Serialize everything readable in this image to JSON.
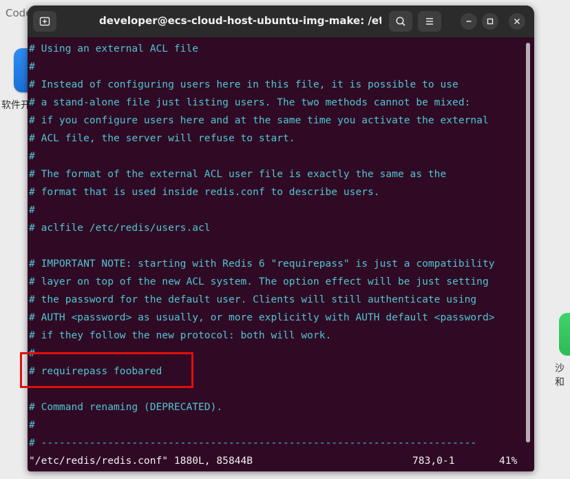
{
  "desktop": {
    "top_left_label": "Code",
    "left_icon_label": "软件开",
    "right_icon_label": "沙和"
  },
  "window": {
    "title": "developer@ecs-cloud-host-ubuntu-img-make: /etc/redis",
    "icons": {
      "new_tab": "new-tab-icon",
      "search": "search-icon",
      "menu": "hamburger-menu-icon",
      "minimize": "minimize-icon",
      "maximize": "maximize-icon",
      "close": "close-icon"
    }
  },
  "terminal": {
    "text_color": "#4ec6d3",
    "background": "#300a24",
    "lines": [
      "# Using an external ACL file",
      "#",
      "# Instead of configuring users here in this file, it is possible to use",
      "# a stand-alone file just listing users. The two methods cannot be mixed:",
      "# if you configure users here and at the same time you activate the external",
      "# ACL file, the server will refuse to start.",
      "#",
      "# The format of the external ACL user file is exactly the same as the",
      "# format that is used inside redis.conf to describe users.",
      "#",
      "# aclfile /etc/redis/users.acl",
      "",
      "# IMPORTANT NOTE: starting with Redis 6 \"requirepass\" is just a compatibility",
      "# layer on top of the new ACL system. The option effect will be just setting",
      "# the password for the default user. Clients will still authenticate using",
      "# AUTH <password> as usually, or more explicitly with AUTH default <password>",
      "# if they follow the new protocol: both will work.",
      "#",
      "# requirepass foobared",
      "",
      "# Command renaming (DEPRECATED).",
      "#",
      "# ------------------------------------------------------------------------"
    ],
    "status": {
      "file": "\"/etc/redis/redis.conf\" 1880L, 85844B",
      "position": "783,0-1",
      "percent": "41%"
    },
    "highlight_color": "#e10e0e"
  }
}
